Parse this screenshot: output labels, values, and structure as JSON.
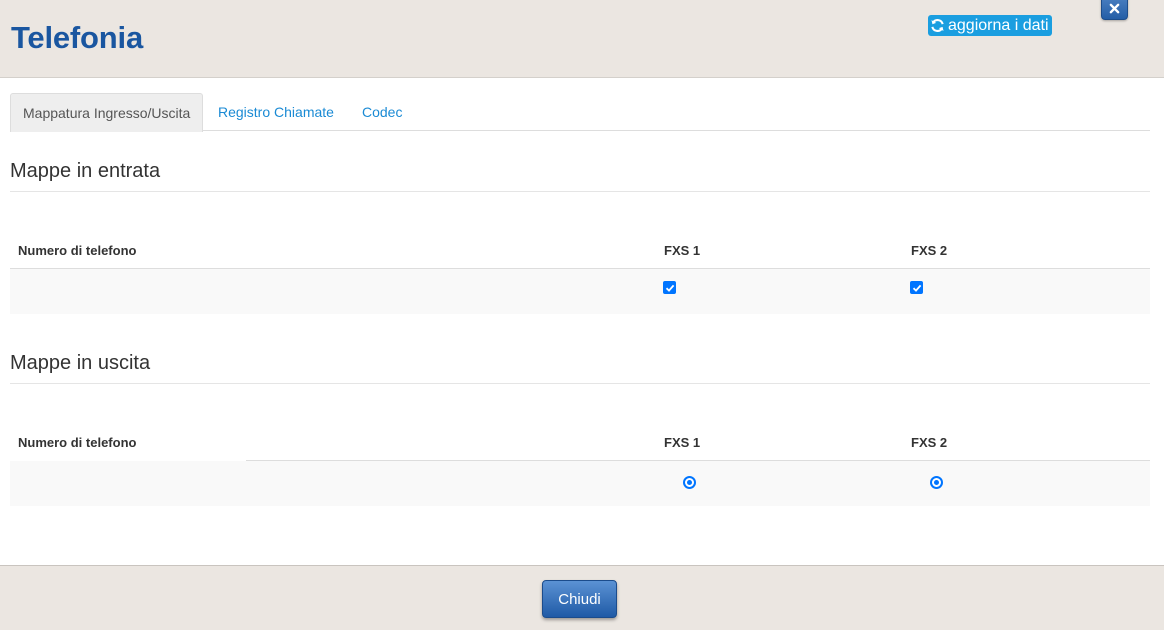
{
  "header": {
    "title": "Telefonia",
    "refresh_label": "aggiorna i dati"
  },
  "tabs": [
    {
      "label": "Mappatura Ingresso/Uscita",
      "active": true
    },
    {
      "label": "Registro Chiamate",
      "active": false
    },
    {
      "label": "Codec",
      "active": false
    }
  ],
  "incoming": {
    "title": "Mappe in entrata",
    "columns": [
      "Numero di telefono",
      "FXS 1",
      "FXS 2"
    ],
    "rows": [
      {
        "phone": "",
        "fxs1_checked": true,
        "fxs2_checked": true
      }
    ]
  },
  "outgoing": {
    "title": "Mappe in uscita",
    "columns": [
      "Numero di telefono",
      "FXS 1",
      "FXS 2"
    ],
    "rows": [
      {
        "phone": "",
        "fxs1_selected": true,
        "fxs2_selected": true
      }
    ]
  },
  "footer": {
    "close_label": "Chiudi"
  },
  "colors": {
    "title": "#1a56a0",
    "accent": "#1a9ee0",
    "link": "#1a8ad4",
    "control": "#0075ff"
  }
}
